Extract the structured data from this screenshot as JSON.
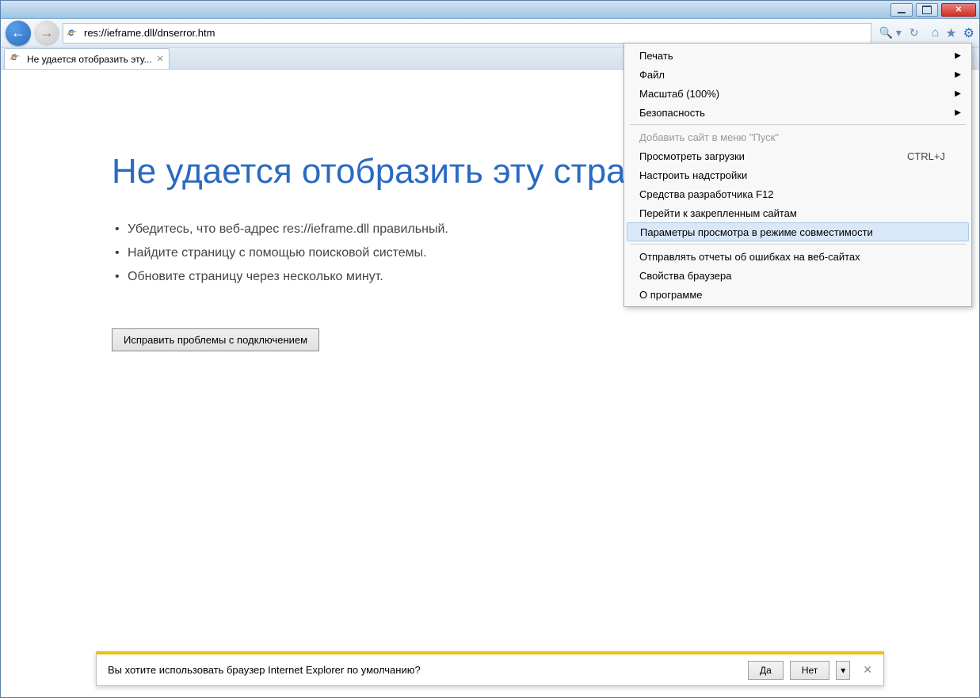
{
  "navbar": {
    "url": "res://ieframe.dll/dnserror.htm"
  },
  "tab": {
    "title": "Не удается отобразить эту..."
  },
  "error": {
    "heading": "Не удается отобразить эту страницу",
    "bullets": [
      "Убедитесь, что веб-адрес res://ieframe.dll правильный.",
      "Найдите страницу с помощью поисковой системы.",
      "Обновите страницу через несколько минут."
    ],
    "fix_button": "Исправить проблемы с подключением"
  },
  "menu": {
    "groups": [
      [
        {
          "label": "Печать",
          "submenu": true
        },
        {
          "label": "Файл",
          "submenu": true
        },
        {
          "label": "Масштаб (100%)",
          "submenu": true
        },
        {
          "label": "Безопасность",
          "submenu": true
        }
      ],
      [
        {
          "label": "Добавить сайт в меню \"Пуск\"",
          "disabled": true
        },
        {
          "label": "Просмотреть загрузки",
          "shortcut": "CTRL+J"
        },
        {
          "label": "Настроить надстройки"
        },
        {
          "label": "Средства разработчика F12"
        },
        {
          "label": "Перейти к закрепленным сайтам"
        },
        {
          "label": "Параметры просмотра в режиме совместимости",
          "highlighted": true
        }
      ],
      [
        {
          "label": "Отправлять отчеты об ошибках на веб-сайтах"
        },
        {
          "label": "Свойства браузера"
        },
        {
          "label": "О программе"
        }
      ]
    ]
  },
  "notification": {
    "message": "Вы хотите использовать браузер Internet Explorer по умолчанию?",
    "yes": "Да",
    "no": "Нет"
  }
}
